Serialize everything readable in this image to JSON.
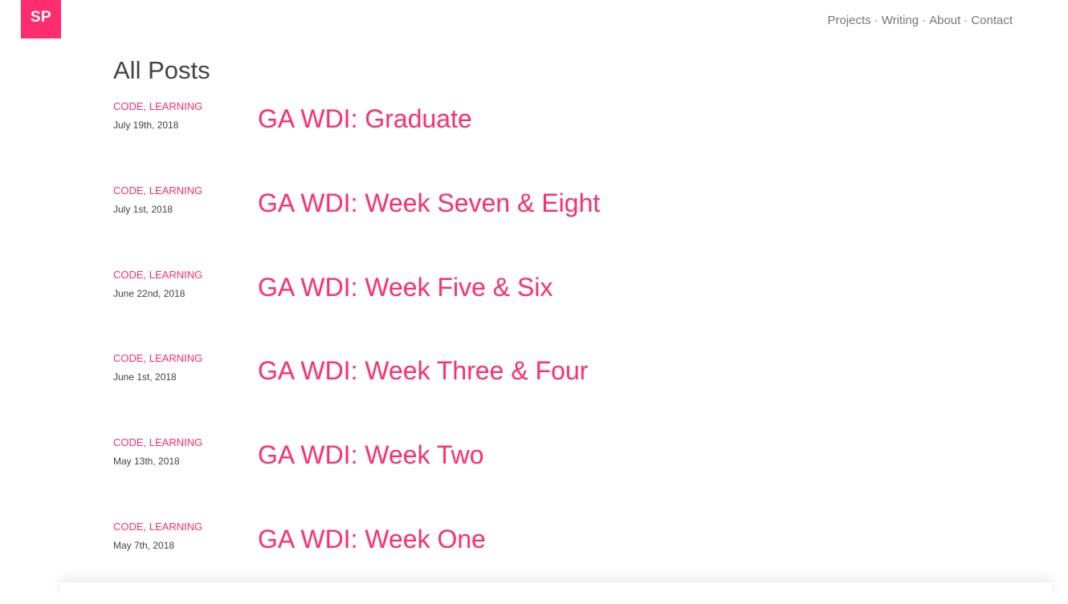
{
  "header": {
    "logo": "SP",
    "nav": [
      "Projects",
      "Writing",
      "About",
      "Contact"
    ],
    "separator": "·"
  },
  "main": {
    "title": "All Posts",
    "posts": [
      {
        "categories": "CODE, LEARNING",
        "date": "July 19th, 2018",
        "title": "GA WDI: Graduate"
      },
      {
        "categories": "CODE, LEARNING",
        "date": "July 1st, 2018",
        "title": "GA WDI: Week Seven & Eight"
      },
      {
        "categories": "CODE, LEARNING",
        "date": "June 22nd, 2018",
        "title": "GA WDI: Week Five & Six"
      },
      {
        "categories": "CODE, LEARNING",
        "date": "June 1st, 2018",
        "title": "GA WDI: Week Three & Four"
      },
      {
        "categories": "CODE, LEARNING",
        "date": "May 13th, 2018",
        "title": "GA WDI: Week Two"
      },
      {
        "categories": "CODE, LEARNING",
        "date": "May 7th, 2018",
        "title": "GA WDI: Week One"
      }
    ]
  },
  "colors": {
    "accent": "#ff2d6f",
    "text": "#444444",
    "nav": "#777777"
  }
}
